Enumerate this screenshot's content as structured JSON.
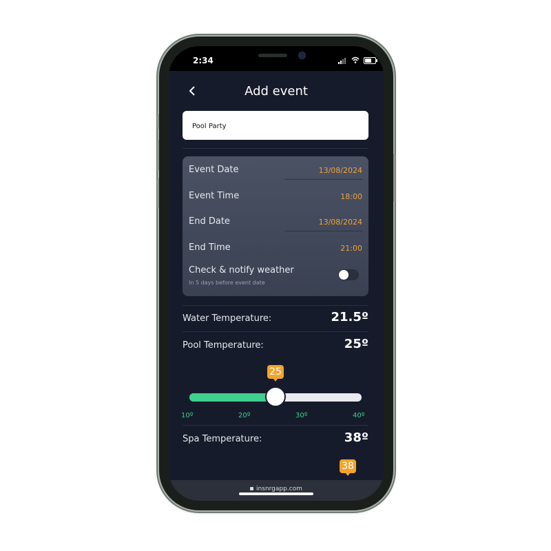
{
  "status_bar": {
    "time": "2:34"
  },
  "header": {
    "back_icon": "chevron-left-icon",
    "title": "Add event"
  },
  "event_name": {
    "value": "Pool Party"
  },
  "schedule": {
    "event_date_label": "Event Date",
    "event_date_value": "13/08/2024",
    "event_time_label": "Event Time",
    "event_time_value": "18:00",
    "end_date_label": "End Date",
    "end_date_value": "13/08/2024",
    "end_time_label": "End Time",
    "end_time_value": "21:00",
    "weather_label": "Check & notify weather",
    "weather_sub": "In 5 days before event date",
    "weather_enabled": false
  },
  "water": {
    "label": "Water Temperature:",
    "value": "21.5º"
  },
  "pool": {
    "label": "Pool Temperature:",
    "value": "25º",
    "slider_bubble": "25",
    "slider_fraction": 0.5,
    "ticks": [
      "10º",
      "20º",
      "30º",
      "40º"
    ]
  },
  "spa": {
    "label": "Spa Temperature:",
    "value": "38º",
    "slider_bubble": "38"
  },
  "browser": {
    "url": "insnrgapp.com"
  },
  "colors": {
    "accent_orange": "#f2a42a",
    "accent_green": "#3fcf8e",
    "background": "#161b2b"
  }
}
